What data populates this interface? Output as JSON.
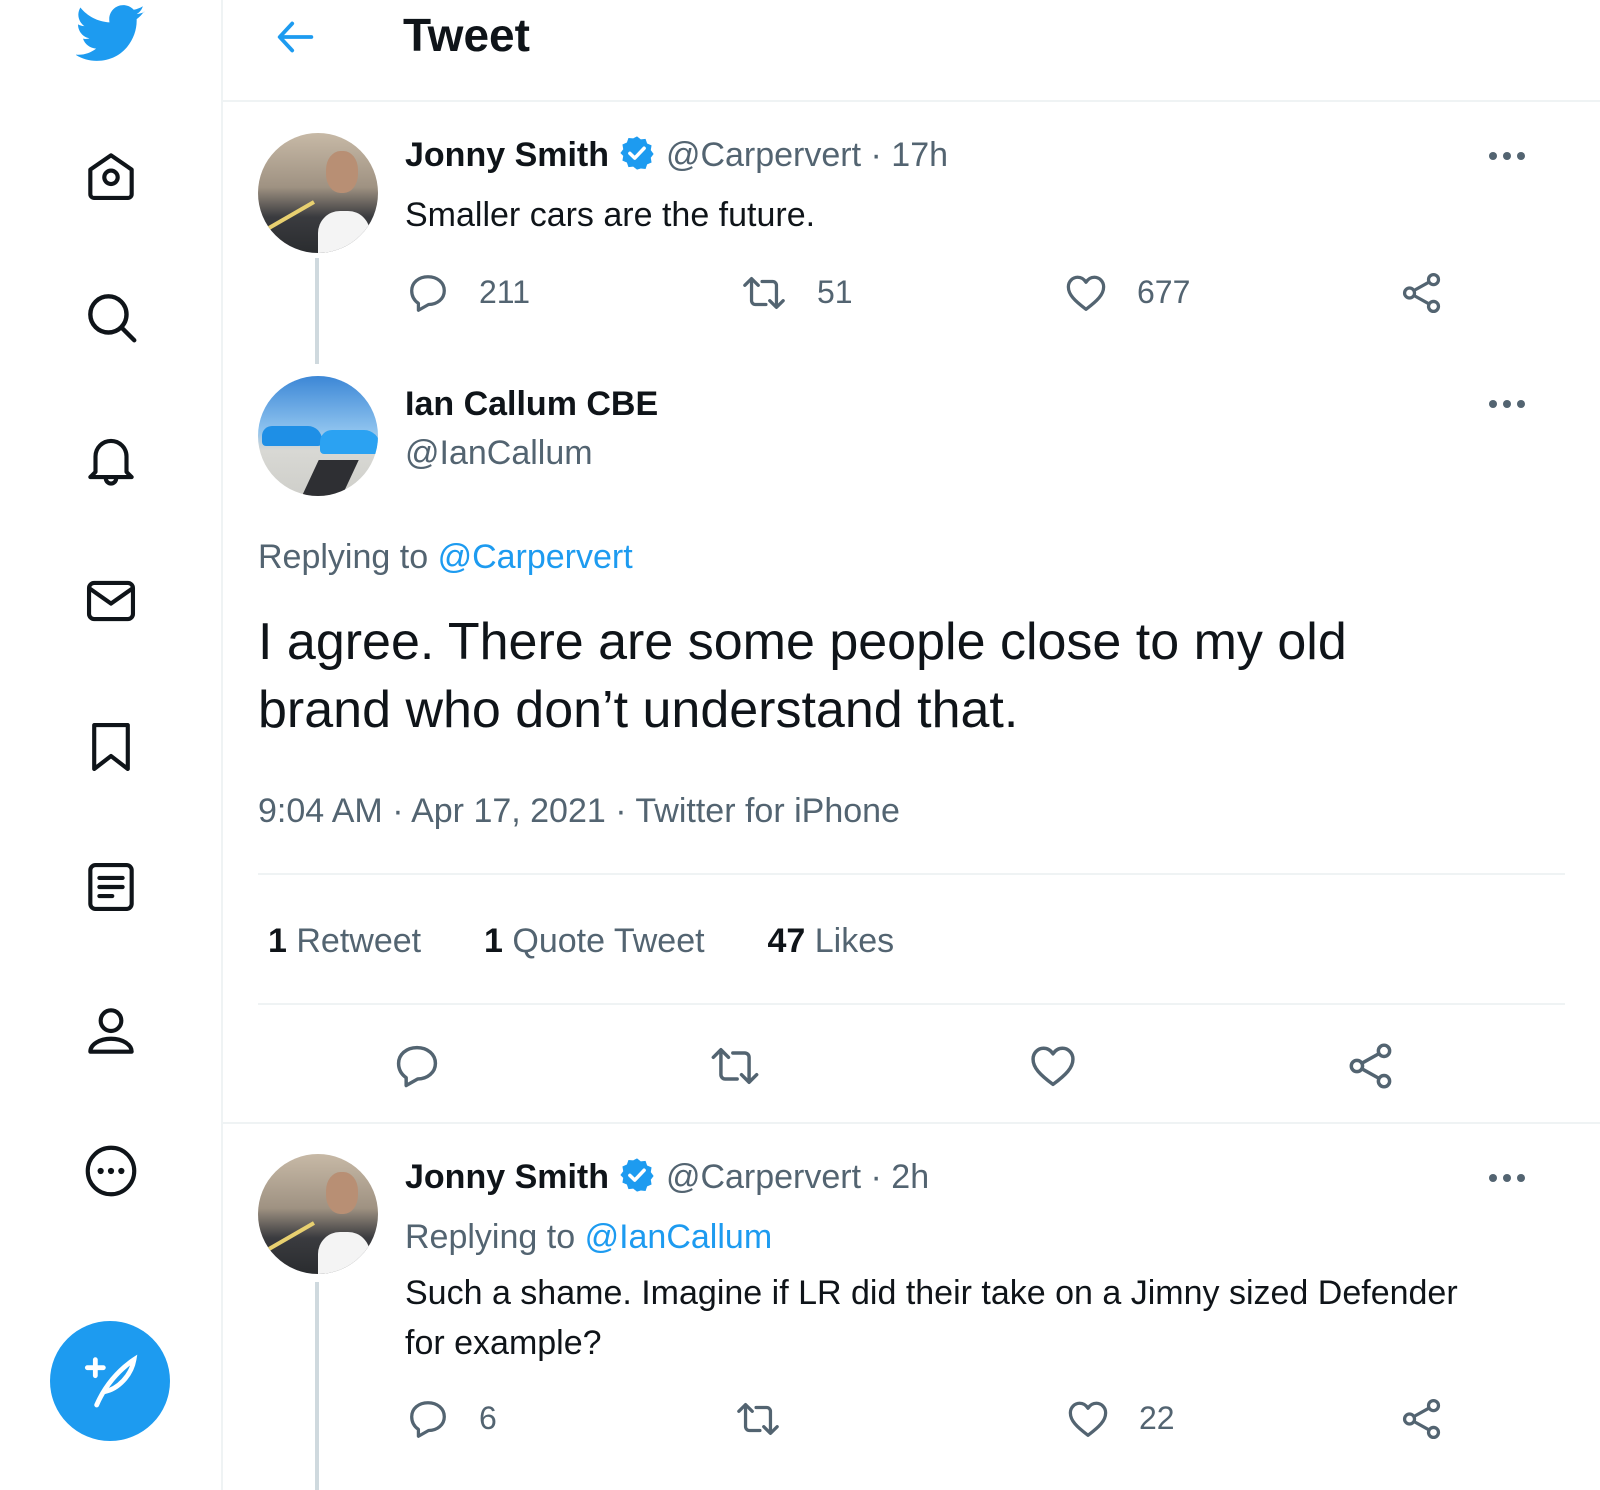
{
  "header": {
    "title": "Tweet"
  },
  "sidebar": {
    "items": [
      {
        "icon": "home-icon"
      },
      {
        "icon": "explore-icon"
      },
      {
        "icon": "notifications-icon"
      },
      {
        "icon": "messages-icon"
      },
      {
        "icon": "bookmarks-icon"
      },
      {
        "icon": "lists-icon"
      },
      {
        "icon": "profile-icon"
      },
      {
        "icon": "more-icon"
      }
    ],
    "compose_icon": "compose-tweet-icon"
  },
  "parent_tweet": {
    "name": "Jonny Smith",
    "handle": "@Carpervert",
    "time": "· 17h",
    "text": "Smaller cars are the future.",
    "replies": "211",
    "retweets": "51",
    "likes": "677"
  },
  "main_tweet": {
    "name": "Ian Callum CBE",
    "handle": "@IanCallum",
    "replying_to_label": "Replying to",
    "replying_to_handle": "@Carpervert",
    "text": "I agree. There are some people close to my old brand who don’t understand that.",
    "meta": "9:04 AM · Apr 17, 2021 · Twitter for iPhone",
    "retweet_count": "1",
    "retweet_label": "Retweet",
    "quote_count": "1",
    "quote_label": "Quote Tweet",
    "like_count": "47",
    "like_label": "Likes"
  },
  "reply_tweet": {
    "name": "Jonny Smith",
    "handle": "@Carpervert",
    "time": "· 2h",
    "replying_to_label": "Replying to",
    "replying_to_handle": "@IanCallum",
    "text": "Such a shame. Imagine if LR did their take on a Jimny sized Defender for example?",
    "replies": "6",
    "retweets": "",
    "likes": "22"
  },
  "colors": {
    "accent": "#1d9bf0",
    "muted": "#536471",
    "border": "#eff3f4"
  }
}
